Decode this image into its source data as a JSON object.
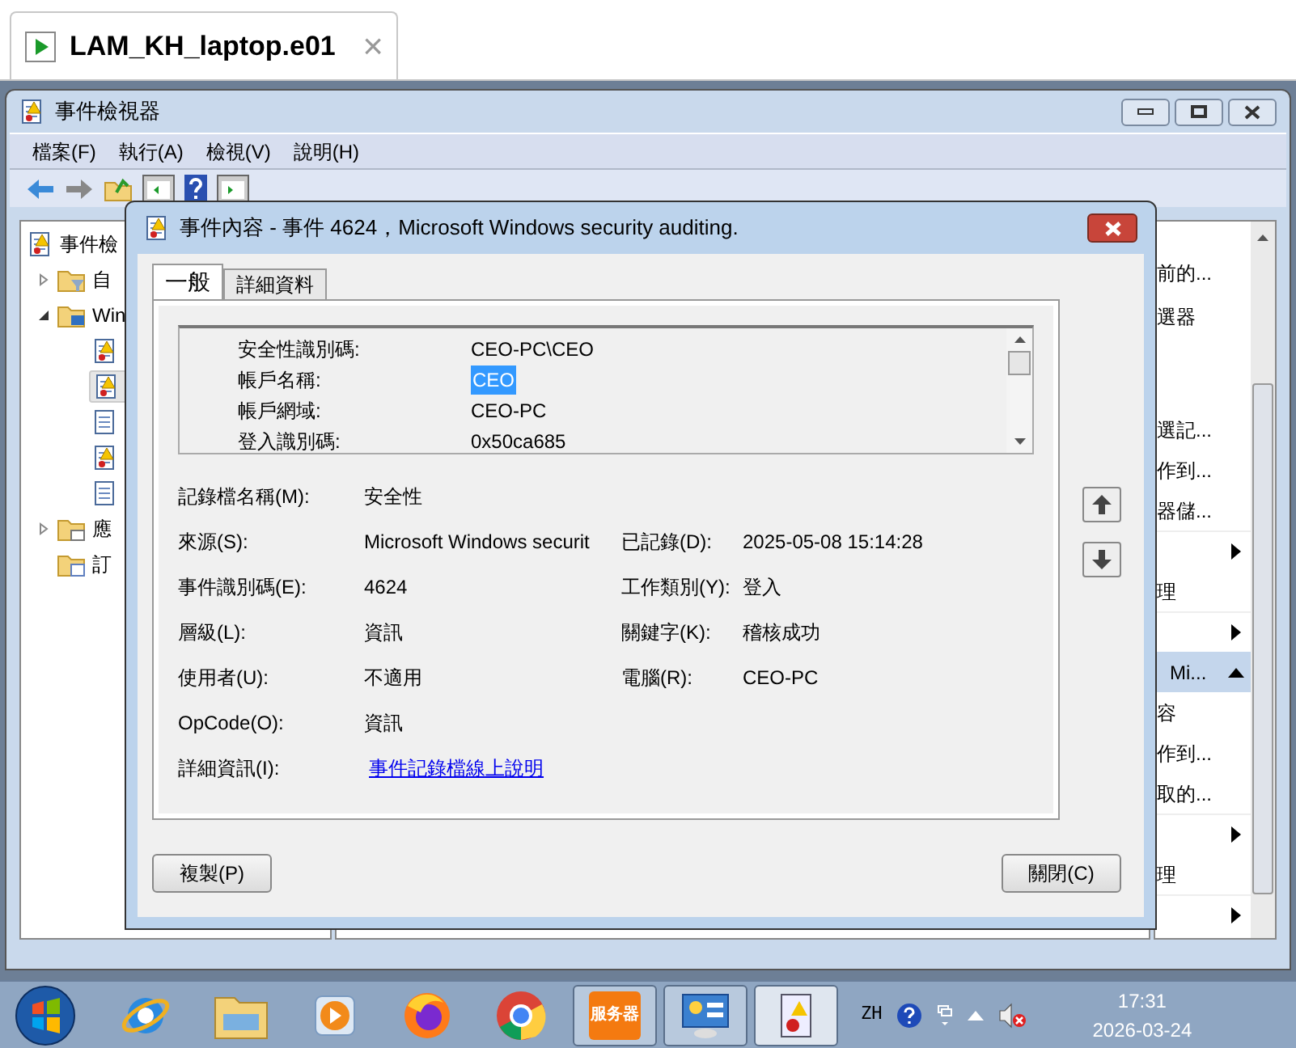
{
  "file_tab": {
    "title": "LAM_KH_laptop.e01",
    "close": "×"
  },
  "window": {
    "title": "事件檢視器"
  },
  "menu": [
    "檔案(F)",
    "執行(A)",
    "檢視(V)",
    "說明(H)"
  ],
  "tree": {
    "label": "事件檢",
    "children": [
      {
        "label": "自",
        "kind": "filter",
        "expanded": false
      },
      {
        "label": "Win",
        "kind": "computer",
        "expanded": true,
        "children": [
          {
            "kind": "warning",
            "selected": false
          },
          {
            "kind": "warning",
            "selected": true
          },
          {
            "kind": "plain",
            "selected": false
          },
          {
            "kind": "warning",
            "selected": false
          },
          {
            "kind": "plain",
            "selected": false
          }
        ]
      },
      {
        "label": "應",
        "kind": "folder",
        "expanded": false
      },
      {
        "label": "訂",
        "kind": "calendar"
      }
    ]
  },
  "actions_top": [
    "前的...",
    "選器"
  ],
  "actions": [
    {
      "kind": "text",
      "label": "選記..."
    },
    {
      "kind": "text",
      "label": "作到..."
    },
    {
      "kind": "text",
      "label": "器儲..."
    },
    {
      "kind": "submenu"
    },
    {
      "kind": "text",
      "label": "理"
    },
    {
      "kind": "submenu"
    },
    {
      "kind": "header",
      "label": "Mi..."
    },
    {
      "kind": "text",
      "label": "容"
    },
    {
      "kind": "text",
      "label": "作到..."
    },
    {
      "kind": "text",
      "label": "取的..."
    },
    {
      "kind": "submenu"
    },
    {
      "kind": "text",
      "label": "理"
    },
    {
      "kind": "submenu"
    }
  ],
  "dialog": {
    "title": "事件內容 - 事件 4624，Microsoft Windows security auditing.",
    "tabs": [
      {
        "label": "一般",
        "selected": true
      },
      {
        "label": "詳細資料",
        "selected": false
      }
    ],
    "description_rows": [
      {
        "label": "安全性識別碼:",
        "value": "CEO-PC\\CEO",
        "selected": false
      },
      {
        "label": "帳戶名稱:",
        "value": "CEO",
        "selected": true
      },
      {
        "label": "帳戶網域:",
        "value": "CEO-PC",
        "selected": false
      },
      {
        "label": "登入識別碼:",
        "value": "0x50ca685",
        "selected": false
      }
    ],
    "fields": [
      {
        "label": "記錄檔名稱(M):",
        "value": "安全性"
      },
      {
        "label": "來源(S):",
        "value": "Microsoft Windows securit",
        "label2": "已記錄(D):",
        "value2": "2025-05-08 15:14:28"
      },
      {
        "label": "事件識別碼(E):",
        "value": "4624",
        "label2": "工作類別(Y):",
        "value2": "登入"
      },
      {
        "label": "層級(L):",
        "value": "資訊",
        "label2": "關鍵字(K):",
        "value2": "稽核成功"
      },
      {
        "label": "使用者(U):",
        "value": "不適用",
        "label2": "電腦(R):",
        "value2": "CEO-PC"
      },
      {
        "label": "OpCode(O):",
        "value": "資訊"
      },
      {
        "label": "詳細資訊(I):",
        "value": "事件記錄檔線上說明",
        "kind": "link"
      }
    ],
    "copy_button": "複製(P)",
    "close_button": "關閉(C)"
  },
  "taskbar": {
    "pinned": [
      {
        "kind": "ie"
      },
      {
        "kind": "explorer"
      },
      {
        "kind": "media"
      },
      {
        "kind": "firefox"
      },
      {
        "kind": "chrome"
      }
    ],
    "windows": [
      {
        "kind": "server",
        "label": "服务器",
        "active": false
      },
      {
        "kind": "control",
        "active": false
      },
      {
        "kind": "eventviewer",
        "active": true
      }
    ],
    "language": "ZH",
    "time": "17:31",
    "date": "2026-03-24"
  }
}
